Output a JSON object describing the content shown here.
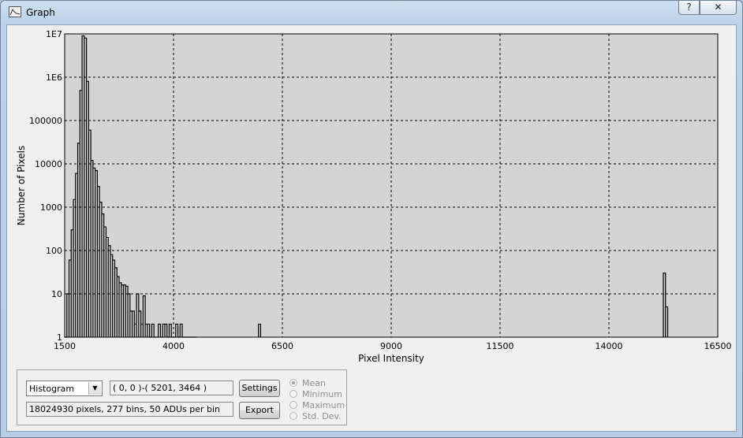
{
  "window": {
    "title": "Graph",
    "icon": "graph-window-icon",
    "help_label": "?",
    "close_label": "✕"
  },
  "chart_data": {
    "type": "histogram",
    "xlabel": "Pixel Intensity",
    "ylabel": "Number of Pixels",
    "xlim": [
      1500,
      16500
    ],
    "x_ticks": [
      "1500",
      "4000",
      "6500",
      "9000",
      "11500",
      "14000",
      "16500"
    ],
    "y_scale": "log",
    "ylim": [
      1,
      10000000
    ],
    "y_ticks": [
      "1",
      "10",
      "100",
      "1000",
      "10000",
      "100000",
      "1E6",
      "1E7"
    ],
    "grid": true,
    "bin_width": 50,
    "bins_x_start": [
      1500,
      1550,
      1600,
      1650,
      1700,
      1750,
      1800,
      1850,
      1900,
      1950,
      2000,
      2050,
      2100,
      2150,
      2200,
      2250,
      2300,
      2350,
      2400,
      2450,
      2500,
      2550,
      2600,
      2650,
      2700,
      2750,
      2800,
      2850,
      2900,
      2950,
      3000,
      3050,
      3100,
      3150,
      3200,
      3250,
      3300,
      3350,
      3400,
      3450,
      3500,
      3550,
      3600,
      3650,
      3700,
      3750,
      3800,
      3850,
      3900,
      3950,
      4000,
      4050,
      4100,
      4150,
      4200,
      4250,
      4300,
      4350,
      4400,
      4450,
      4500,
      5950,
      15250,
      15300
    ],
    "counts": [
      1,
      10,
      60,
      300,
      1500,
      6000,
      30000,
      500000,
      9000000,
      8000000,
      800000,
      60000,
      12000,
      8000,
      7000,
      3000,
      1300,
      700,
      350,
      200,
      130,
      80,
      60,
      40,
      25,
      18,
      16,
      16,
      15,
      10,
      4,
      4,
      2,
      10,
      4,
      2,
      9,
      2,
      2,
      1,
      2,
      1,
      1,
      2,
      1,
      2,
      2,
      1,
      2,
      1,
      1,
      2,
      1,
      2,
      1,
      1,
      1,
      1,
      1,
      1,
      1,
      2,
      30,
      5
    ]
  },
  "controls": {
    "plot_type": "Histogram",
    "roi": "( 0, 0 )-( 5201, 3464 )",
    "info": "18024930 pixels, 277 bins, 50 ADUs per bin",
    "settings_label": "Settings",
    "export_label": "Export",
    "stats": {
      "mean": "Mean",
      "minimum": "Minimum",
      "maximum": "Maximum",
      "std_dev": "Std. Dev."
    },
    "selected_stat": "Mean"
  }
}
